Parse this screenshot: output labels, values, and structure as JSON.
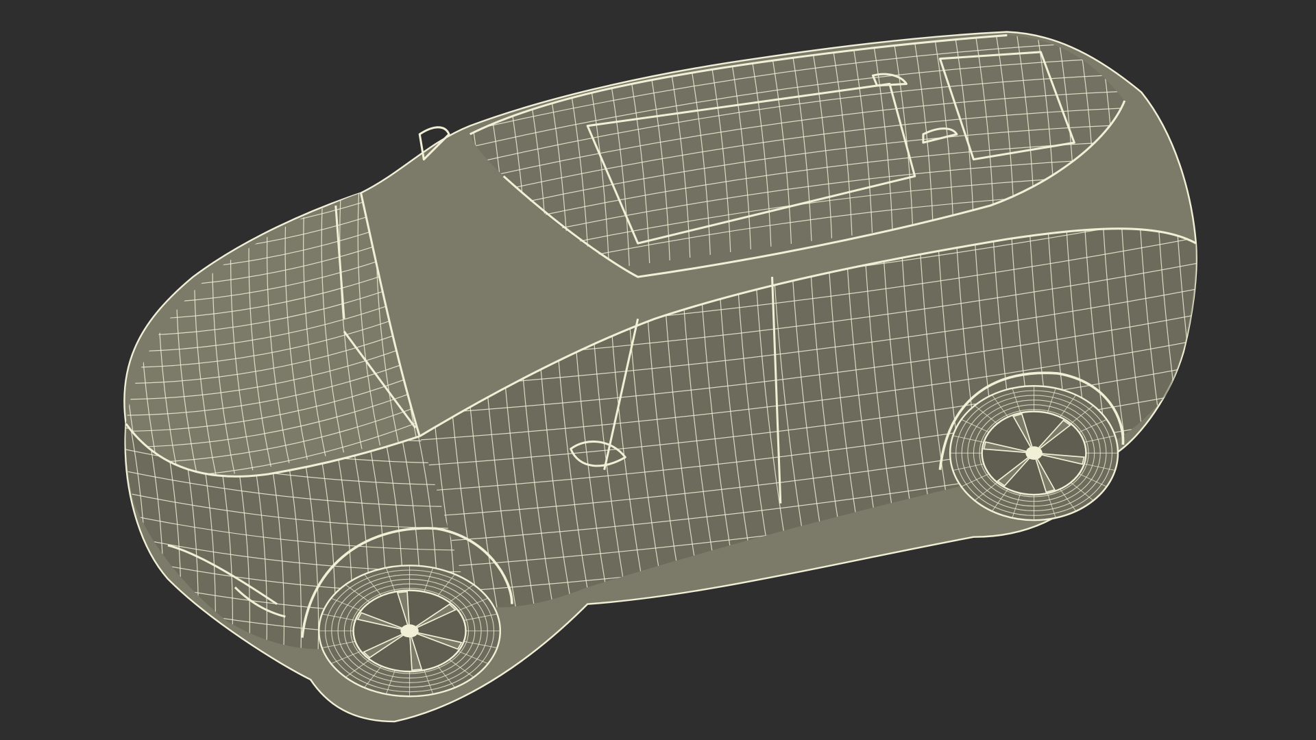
{
  "scene": {
    "background_color": "#2e2e2e",
    "shading_color": "#7c7b6a",
    "shading_dark": "#5f5e50",
    "window_color": "#727162",
    "wire_color": "#f1efd6",
    "tire_color": "#6c6b5c"
  }
}
